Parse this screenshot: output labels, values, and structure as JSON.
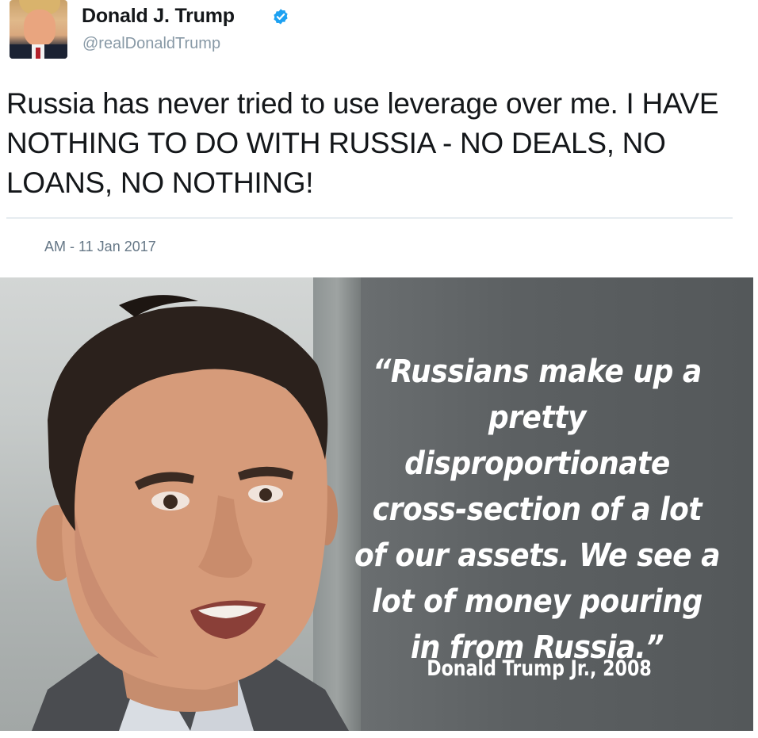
{
  "tweet": {
    "author_name": "Donald J. Trump",
    "author_handle": "@realDonaldTrump",
    "verified": true,
    "text": "Russia has never tried to use leverage over me. I HAVE NOTHING TO DO WITH RUSSIA - NO DEALS, NO LOANS, NO NOTHING!",
    "timestamp": "AM - 11 Jan 2017"
  },
  "meme": {
    "quote": "“Russians make up a pretty disproportionate cross-section of a lot of our assets. We see a lot of money pouring in from Russia.”",
    "attribution": "Donald Trump Jr., 2008"
  },
  "colors": {
    "verified_badge": "#1da1f2",
    "text_primary": "#14171a",
    "text_secondary": "#8899a6"
  },
  "icons": {
    "verified": "verified-badge-icon"
  }
}
